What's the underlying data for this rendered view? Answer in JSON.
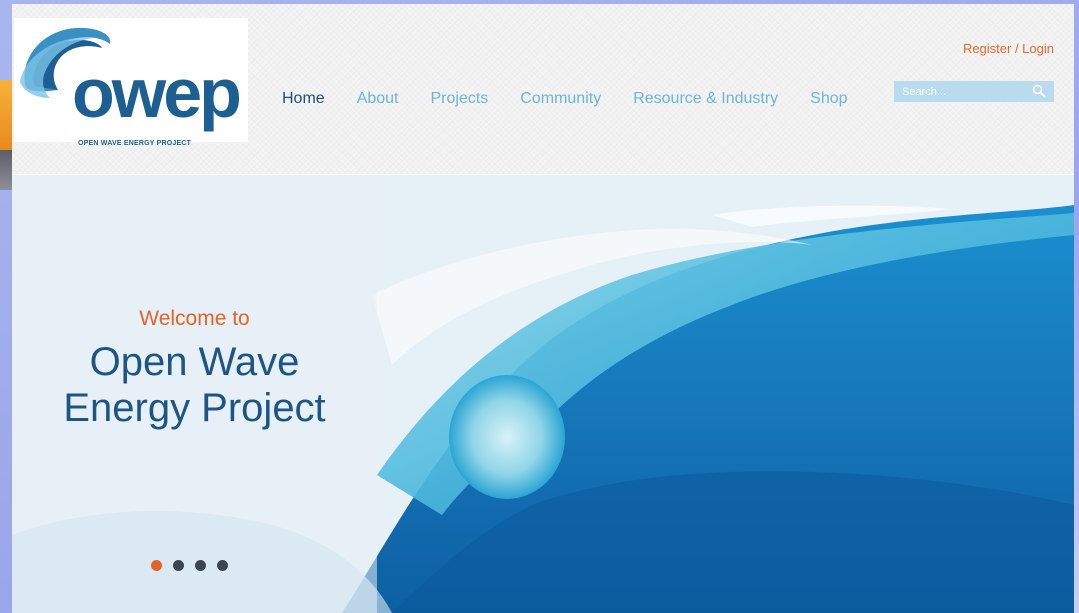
{
  "logo": {
    "word": "owep",
    "tagline": "OPEN WAVE ENERGY PROJECT"
  },
  "header": {
    "register_login": "Register / Login",
    "search": {
      "placeholder": "Search...",
      "icon": "search-icon"
    }
  },
  "nav": {
    "items": [
      {
        "label": "Home",
        "active": true
      },
      {
        "label": "About"
      },
      {
        "label": "Projects"
      },
      {
        "label": "Community"
      },
      {
        "label": "Resource & Industry"
      },
      {
        "label": "Shop"
      }
    ]
  },
  "hero": {
    "welcome": "Welcome to",
    "title_line1": "Open Wave",
    "title_line2": "Energy Project",
    "slides": {
      "count": 4,
      "active_index": 0
    }
  },
  "colors": {
    "accent_orange": "#e2642b",
    "brand_blue": "#1d5f91",
    "nav_light_blue": "#6cb6d6"
  }
}
